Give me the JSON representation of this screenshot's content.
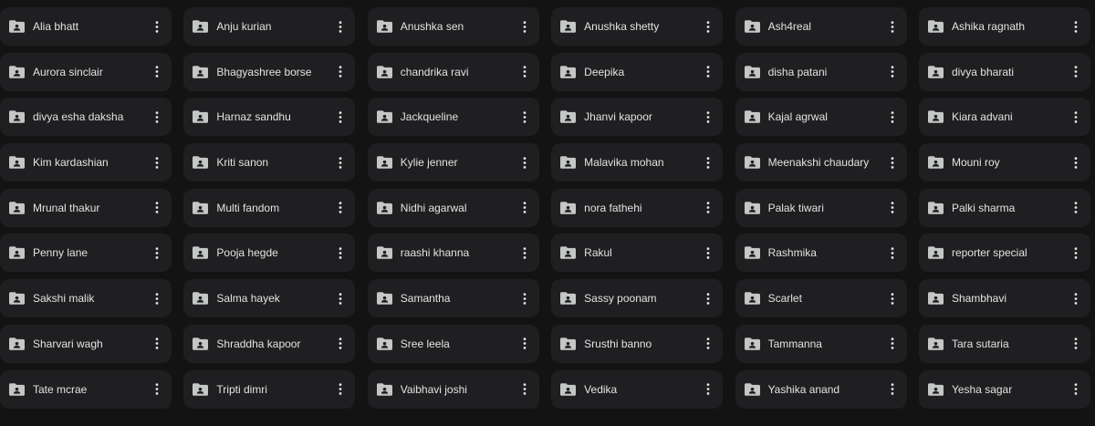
{
  "folders": [
    "Alia bhatt",
    "Anju kurian",
    "Anushka sen",
    "Anushka shetty",
    "Ash4real",
    "Ashika ragnath",
    "Aurora sinclair",
    "Bhagyashree borse",
    "chandrika ravi",
    "Deepika",
    "disha patani",
    "divya bharati",
    "divya esha daksha",
    "Harnaz sandhu",
    "Jackqueline",
    "Jhanvi kapoor",
    "Kajal agrwal",
    "Kiara advani",
    "Kim kardashian",
    "Kriti sanon",
    "Kylie jenner",
    "Malavika mohan",
    "Meenakshi chaudary",
    "Mouni roy",
    "Mrunal thakur",
    "Multi fandom",
    "Nidhi agarwal",
    "nora fathehi",
    "Palak tiwari",
    "Palki sharma",
    "Penny lane",
    "Pooja hegde",
    "raashi khanna",
    "Rakul",
    "Rashmika",
    "reporter special",
    "Sakshi malik",
    "Salma hayek",
    "Samantha",
    "Sassy poonam",
    "Scarlet",
    "Shambhavi",
    "Sharvari wagh",
    "Shraddha kapoor",
    "Sree leela",
    "Srusthi banno",
    "Tammanna",
    "Tara sutaria",
    "Tate mcrae",
    "Tripti dimri",
    "Vaibhavi joshi",
    "Vedika",
    "Yashika anand",
    "Yesha sagar"
  ],
  "icons": {
    "folder": "shared-folder-icon",
    "more": "more-vert-icon"
  },
  "colors": {
    "background": "#131314",
    "card": "#1f1f21",
    "text": "#e3e3e3",
    "icon": "#c4c7c5"
  }
}
